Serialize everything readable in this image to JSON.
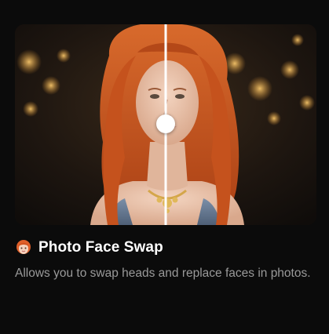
{
  "card": {
    "title": "Photo Face Swap",
    "title_icon": "woman-red-hair-icon",
    "description": "Allows you to swap heads and replace faces in photos.",
    "compare_slider": {
      "position": 0.5,
      "handle_icon": "slider-handle-circle"
    }
  },
  "colors": {
    "background": "#0b0b0b",
    "title": "#ffffff",
    "description": "#9a9a9a",
    "divider": "#ffffff",
    "hair": "#c5521d"
  }
}
